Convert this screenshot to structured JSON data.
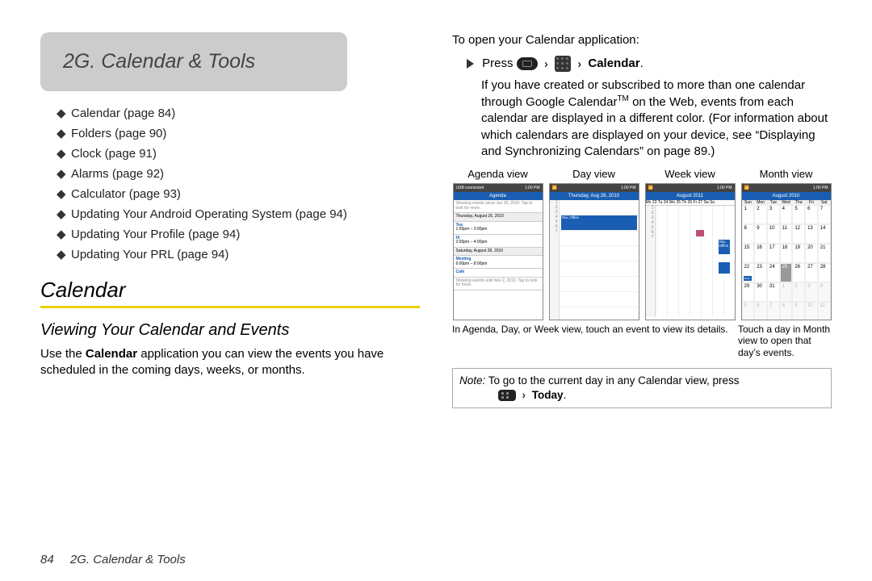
{
  "chapter_title": "2G. Calendar & Tools",
  "toc": [
    "Calendar (page 84)",
    "Folders (page 90)",
    "Clock (page 91)",
    "Alarms (page 92)",
    "Calculator (page 93)",
    "Updating Your Android Operating System (page 94)",
    "Updating Your Profile (page 94)",
    "Updating Your PRL (page 94)"
  ],
  "section_title": "Calendar",
  "sub_title": "Viewing Your Calendar and Events",
  "body_pre": "Use the ",
  "body_bold": "Calendar",
  "body_post": " application you can view the events you have scheduled in the coming days, weeks, or months.",
  "open_line": "To open your Calendar application:",
  "press_word": "Press",
  "calendar_word": "Calendar",
  "open_paragraph": "If you have created or subscribed to more than one calendar through Google Calendar",
  "open_paragraph2": " on the Web, events from each calendar are displayed in a different color. (For information about which calendars are displayed on your device, see “Displaying and Synchronizing Calendars” on page 89.)",
  "tm": "TM",
  "views": [
    "Agenda view",
    "Day view",
    "Week view",
    "Month view"
  ],
  "status_left": "USB connected",
  "status_right": "1:00 PM",
  "agenda_title": "Agenda",
  "agenda_top": "Showing events since Jun 26, 2010. Tap to look for more.",
  "agenda_day1": "Thursday, August 26, 2010",
  "agenda_ev1_t": "Tea",
  "agenda_ev1_s": "1:00pm – 2:00pm",
  "agenda_ev2_t": "Hi",
  "agenda_ev2_s": "2:00pm – 4:00pm",
  "agenda_day2": "Saturday, August 28, 2010",
  "agenda_ev3_t": "Meeting",
  "agenda_ev3_s": "6:00pm – 8:00pm",
  "agenda_ev4_t": "Cafe",
  "agenda_bottom": "Showing events until Nov 2, 2010. Tap to look for more.",
  "day_title": "Thursday, Aug 26, 2010",
  "day_ev": "Tea, Office",
  "week_title": "August 2011",
  "week_days": "Mn 23 Tu 24 We 25 Th 26 Fr 27 Sa Su",
  "month_title": "August 2010",
  "month_dow": [
    "Sun",
    "Mon",
    "Tue",
    "Wed",
    "Thu",
    "Fri",
    "Sat"
  ],
  "month_cells": [
    {
      "n": "1"
    },
    {
      "n": "2"
    },
    {
      "n": "3"
    },
    {
      "n": "4"
    },
    {
      "n": "5"
    },
    {
      "n": "6"
    },
    {
      "n": "7"
    },
    {
      "n": "8"
    },
    {
      "n": "9"
    },
    {
      "n": "10"
    },
    {
      "n": "11"
    },
    {
      "n": "12"
    },
    {
      "n": "13"
    },
    {
      "n": "14"
    },
    {
      "n": "15"
    },
    {
      "n": "16"
    },
    {
      "n": "17"
    },
    {
      "n": "18"
    },
    {
      "n": "19"
    },
    {
      "n": "20"
    },
    {
      "n": "21"
    },
    {
      "n": "22"
    },
    {
      "n": "23"
    },
    {
      "n": "24"
    },
    {
      "n": "25"
    },
    {
      "n": "26"
    },
    {
      "n": "27"
    },
    {
      "n": "28"
    },
    {
      "n": "29"
    },
    {
      "n": "30"
    },
    {
      "n": "31"
    },
    {
      "n": "1",
      "off": true
    },
    {
      "n": "2",
      "off": true
    },
    {
      "n": "3",
      "off": true
    },
    {
      "n": "4",
      "off": true
    },
    {
      "n": "5",
      "off": true
    },
    {
      "n": "6",
      "off": true
    },
    {
      "n": "7",
      "off": true
    },
    {
      "n": "8",
      "off": true
    },
    {
      "n": "9",
      "off": true
    },
    {
      "n": "10",
      "off": true
    },
    {
      "n": "11",
      "off": true
    }
  ],
  "caption1": "In Agenda, Day, or Week view, touch an event to view its details.",
  "caption2": "Touch a day in Month view to open that day’s events.",
  "note_label": "Note:",
  "note_text": "  To go to the current day in any Calendar view, press ",
  "note_today": "Today",
  "footer_page": "84",
  "footer_title": "2G. Calendar & Tools"
}
